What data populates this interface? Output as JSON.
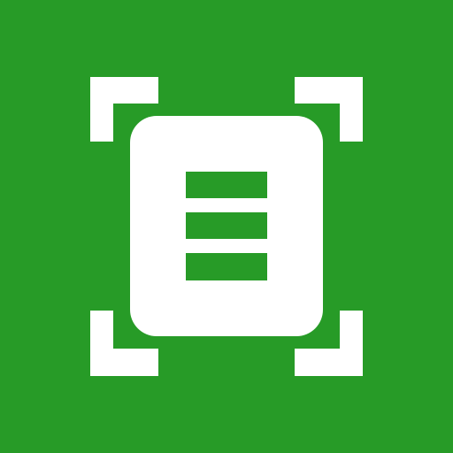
{
  "icon": {
    "name": "document-scanner-icon",
    "colors": {
      "background": "#279B27",
      "foreground": "#FFFFFF"
    }
  }
}
